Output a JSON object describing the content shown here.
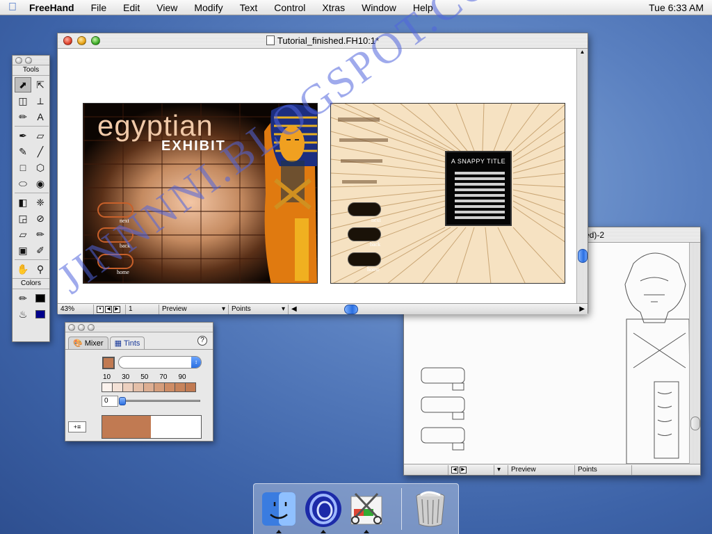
{
  "menubar": {
    "app_name": "FreeHand",
    "items": [
      "File",
      "Edit",
      "View",
      "Modify",
      "Text",
      "Control",
      "Xtras",
      "Window",
      "Help"
    ],
    "clock": "Tue 6:33 AM"
  },
  "main_window": {
    "title": "Tutorial_finished.FH10:1*",
    "zoom": "43%",
    "page": "1",
    "view_mode": "Preview",
    "units": "Points"
  },
  "artwork": {
    "egypt_title": "egyptian",
    "egypt_subtitle": "EXHIBIT",
    "nav_next": "next",
    "nav_back": "back",
    "nav_home": "home",
    "snappy_title": "A SNAPPY TITLE",
    "nav2_next": "next",
    "nav2_back": "back",
    "nav2_home": "home"
  },
  "tools": {
    "heading": "Tools",
    "colors_heading": "Colors"
  },
  "tints_panel": {
    "tab_mixer": "Mixer",
    "tab_tints": "Tints",
    "help": "?",
    "tick_labels": [
      "10",
      "30",
      "50",
      "70",
      "90"
    ],
    "value": "0",
    "base_color": "#c17a52",
    "add_button": "+≡"
  },
  "sketch_window": {
    "title": "ed)-2",
    "view_mode": "Preview",
    "units": "Points"
  },
  "watermark": "JINNNNI.BLOGSPOT.COM",
  "colors": {
    "accent": "#2b6fe0",
    "desktop": "#3d63a8"
  }
}
